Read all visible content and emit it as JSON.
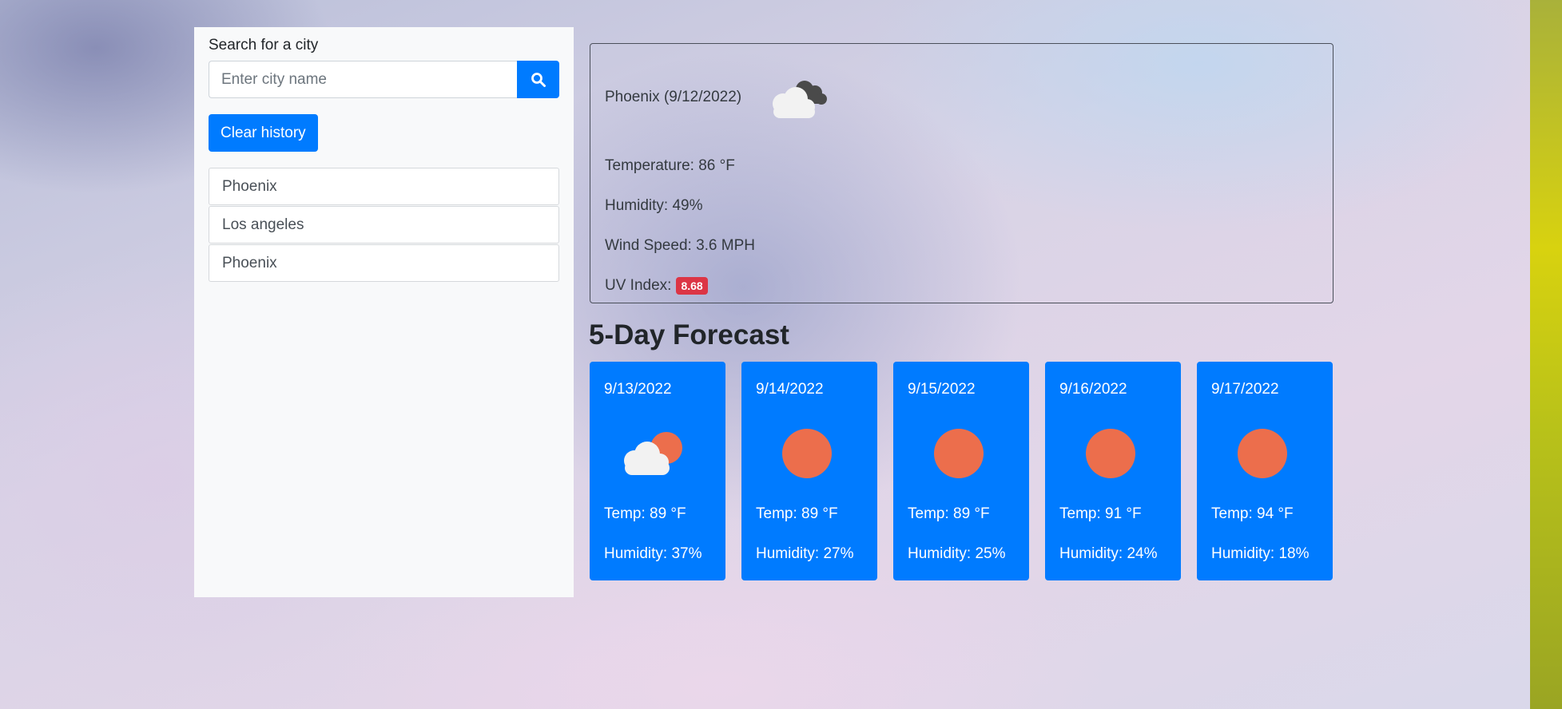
{
  "search": {
    "label": "Search for a city",
    "placeholder": "Enter city name",
    "clear_label": "Clear history"
  },
  "history": [
    "Phoenix",
    "Los angeles",
    "Phoenix"
  ],
  "current": {
    "title": "Phoenix (9/12/2022)",
    "icon": "broken-clouds-icon",
    "temperature": "Temperature: 86 °F",
    "humidity": "Humidity: 49%",
    "wind": "Wind Speed: 3.6 MPH",
    "uv_label": "UV Index:",
    "uv_value": "8.68"
  },
  "forecast": {
    "title": "5-Day Forecast",
    "days": [
      {
        "date": "9/13/2022",
        "icon": "partly-cloudy-icon",
        "temp": "Temp: 89 °F",
        "humidity": "Humidity: 37%"
      },
      {
        "date": "9/14/2022",
        "icon": "sun-icon",
        "temp": "Temp: 89 °F",
        "humidity": "Humidity: 27%"
      },
      {
        "date": "9/15/2022",
        "icon": "sun-icon",
        "temp": "Temp: 89 °F",
        "humidity": "Humidity: 25%"
      },
      {
        "date": "9/16/2022",
        "icon": "sun-icon",
        "temp": "Temp: 91 °F",
        "humidity": "Humidity: 24%"
      },
      {
        "date": "9/17/2022",
        "icon": "sun-icon",
        "temp": "Temp: 94 °F",
        "humidity": "Humidity: 18%"
      }
    ]
  },
  "colors": {
    "primary": "#007bff",
    "danger": "#dc3545",
    "sun": "#ec6e4c"
  }
}
